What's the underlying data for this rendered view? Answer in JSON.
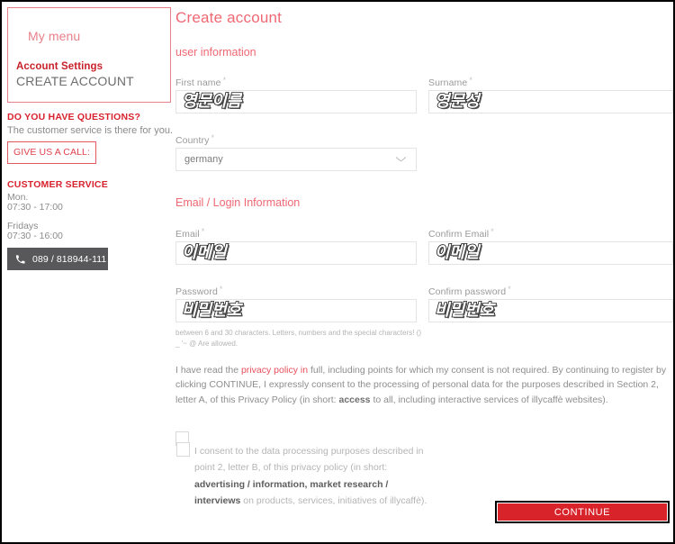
{
  "sidebar": {
    "menu_title": "My menu",
    "account_settings_label": "Account Settings",
    "create_account_label": "CREATE ACCOUNT",
    "questions_title": "DO YOU HAVE QUESTIONS?",
    "questions_subtitle": "The customer service is there for you.",
    "call_button_label": "GIVE US A CALL:",
    "customer_service_title": "CUSTOMER SERVICE",
    "hours": [
      "Mon.",
      "07:30 - 17:00",
      "Fridays",
      "07:30 - 16:00"
    ],
    "phone_icon": "phone-icon",
    "phone_number": "089 / 818944-111"
  },
  "main": {
    "page_title": "Create account",
    "section_user": "user information",
    "section_email": "Email / Login Information",
    "required_mark": "*",
    "fields": {
      "first_name": {
        "label": "First name",
        "value": "영문이름"
      },
      "surname": {
        "label": "Surname",
        "value": "영문성"
      },
      "country": {
        "label": "Country",
        "value": "germany",
        "chevron_icon": "chevron-down-icon"
      },
      "email": {
        "label": "Email",
        "value": "이메일"
      },
      "confirm_email": {
        "label": "Confirm Email",
        "value": "이메일"
      },
      "password": {
        "label": "Password",
        "value": "비밀번호"
      },
      "confirm_password": {
        "label": "Confirm password",
        "value": "비밀번호"
      }
    },
    "password_hint": "between 6 and 30 characters. Letters, numbers and the special characters! () _ '~ @ Are allowed.",
    "policy": {
      "part1": "I have read the ",
      "link": "privacy policy in",
      "part2": " full, including points for which my consent is not required. By continuing to register by clicking CONTINUE, I expressly consent to the processing of personal data for the purposes described in Section 2, letter A, of this Privacy Policy (in short: ",
      "bold": "access",
      "part3": " to all, including interactive services of illycaffè websites)."
    },
    "consent": {
      "part1": "I consent to the data processing purposes described in point 2, letter B, of this privacy policy (in short: ",
      "bold": "advertising / information, market research / interviews",
      "part2": " on products, services, initiatives of illycaffè)."
    },
    "continue_label": "CONTINUE"
  },
  "colors": {
    "brand_red": "#d8232a",
    "heading_pink": "#ef6873",
    "link_red": "#e8505c",
    "muted_gray": "#8e8e8e",
    "phone_bar": "#58585a"
  }
}
